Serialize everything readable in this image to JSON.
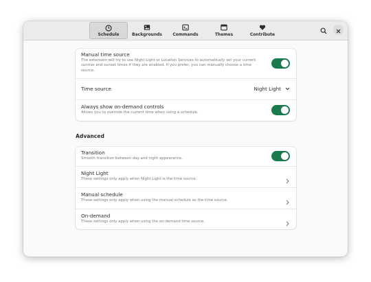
{
  "tabs": [
    {
      "label": "Schedule",
      "icon": "clock-icon",
      "active": true
    },
    {
      "label": "Backgrounds",
      "icon": "image-icon",
      "active": false
    },
    {
      "label": "Commands",
      "icon": "terminal-icon",
      "active": false
    },
    {
      "label": "Themes",
      "icon": "window-icon",
      "active": false
    },
    {
      "label": "Contribute",
      "icon": "heart-icon",
      "active": false
    }
  ],
  "header": {
    "search_icon": "search-icon",
    "close_icon": "close-icon"
  },
  "source_group": {
    "manual_time_source": {
      "title": "Manual time source",
      "subtitle": "The extension will try to use Night Light or Location Services to automatically set your current sunrise and sunset times if they are enabled. If you prefer, you can manually choose a time source.",
      "enabled": true
    },
    "time_source": {
      "title": "Time source",
      "value": "Night Light"
    },
    "on_demand_controls": {
      "title": "Always show on-demand controls",
      "subtitle": "Allows you to override the current time when using a schedule.",
      "enabled": true
    }
  },
  "advanced": {
    "heading": "Advanced",
    "transition": {
      "title": "Transition",
      "subtitle": "Smooth transition between day and night appearance.",
      "enabled": true
    },
    "night_light": {
      "title": "Night Light",
      "subtitle": "These settings only apply when Night Light is the time source."
    },
    "manual_schedule": {
      "title": "Manual schedule",
      "subtitle": "These settings only apply when using the manual schedule as the time source."
    },
    "on_demand": {
      "title": "On-demand",
      "subtitle": "These settings only apply when using the on-demand time source."
    }
  },
  "colors": {
    "accent": "#1a7a4c",
    "header_bg": "#ebebeb",
    "window_bg": "#fafafa"
  }
}
